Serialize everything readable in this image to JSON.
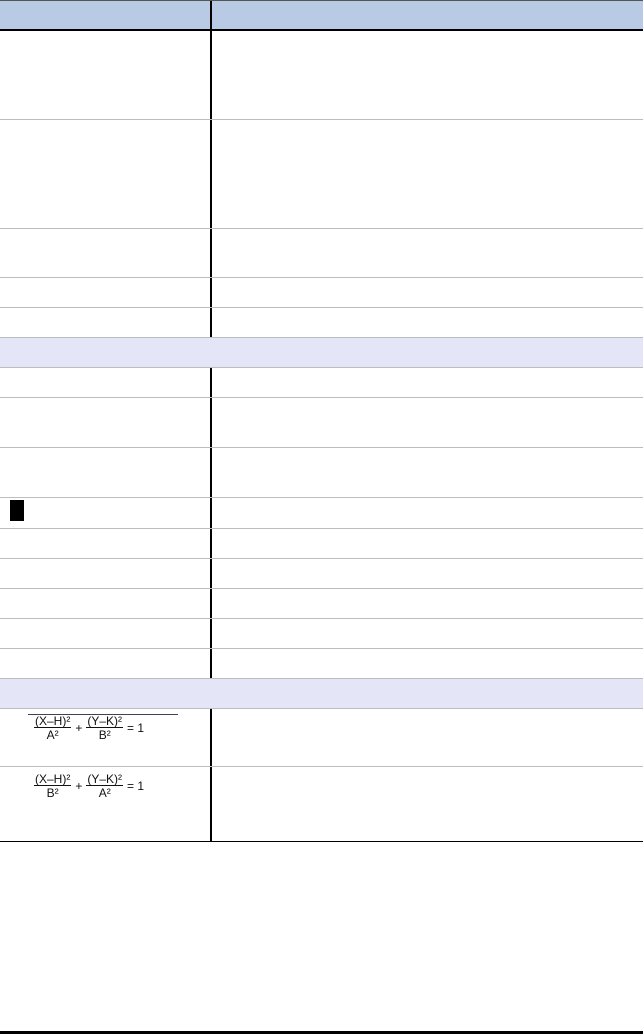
{
  "table": {
    "header": {
      "left": "",
      "right": ""
    },
    "formulas": [
      {
        "term1_num": "(X–H)²",
        "term1_den": "A²",
        "plus": "+",
        "term2_num": "(Y–K)²",
        "term2_den": "B²",
        "equals": "= 1"
      },
      {
        "term1_num": "(X–H)²",
        "term1_den": "B²",
        "plus": "+",
        "term2_num": "(Y–K)²",
        "term2_den": "A²",
        "equals": "= 1"
      }
    ]
  },
  "colors": {
    "header_bg": "#b9cbe4",
    "section_bg": "#e4e6f8",
    "rule": "#000000"
  }
}
